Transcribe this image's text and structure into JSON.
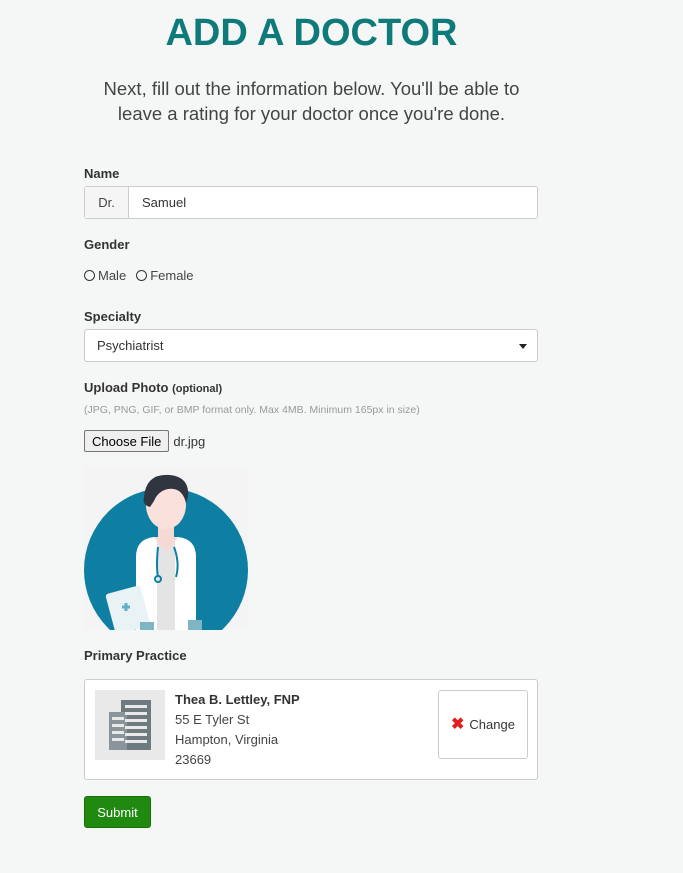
{
  "page": {
    "title": "ADD A DOCTOR",
    "subtitle": "Next, fill out the information below. You'll be able to leave a rating for your doctor once you're done."
  },
  "form": {
    "name": {
      "label": "Name",
      "prefix": "Dr.",
      "value": "Samuel"
    },
    "gender": {
      "label": "Gender",
      "options": [
        "Male",
        "Female"
      ],
      "selected": null
    },
    "specialty": {
      "label": "Specialty",
      "selected": "Psychiatrist"
    },
    "photo": {
      "label": "Upload Photo",
      "optional": "(optional)",
      "hint": "(JPG, PNG, GIF, or BMP format only. Max 4MB. Minimum 165px in size)",
      "choose_label": "Choose File",
      "file_name": "dr.jpg"
    },
    "practice": {
      "label": "Primary Practice",
      "name": "Thea B. Lettley, FNP",
      "address_line1": "55 E Tyler St",
      "address_line2": "Hampton, Virginia",
      "zip": "23669",
      "change_label": "Change"
    },
    "submit_label": "Submit"
  },
  "colors": {
    "title": "#0e7a7a",
    "submit": "#1f8a0f",
    "change_icon": "#e02020",
    "avatar_circle": "#0e7fa3"
  },
  "icons": {
    "building": "building-icon",
    "change": "x-icon",
    "select_caret": "caret-down-icon"
  }
}
